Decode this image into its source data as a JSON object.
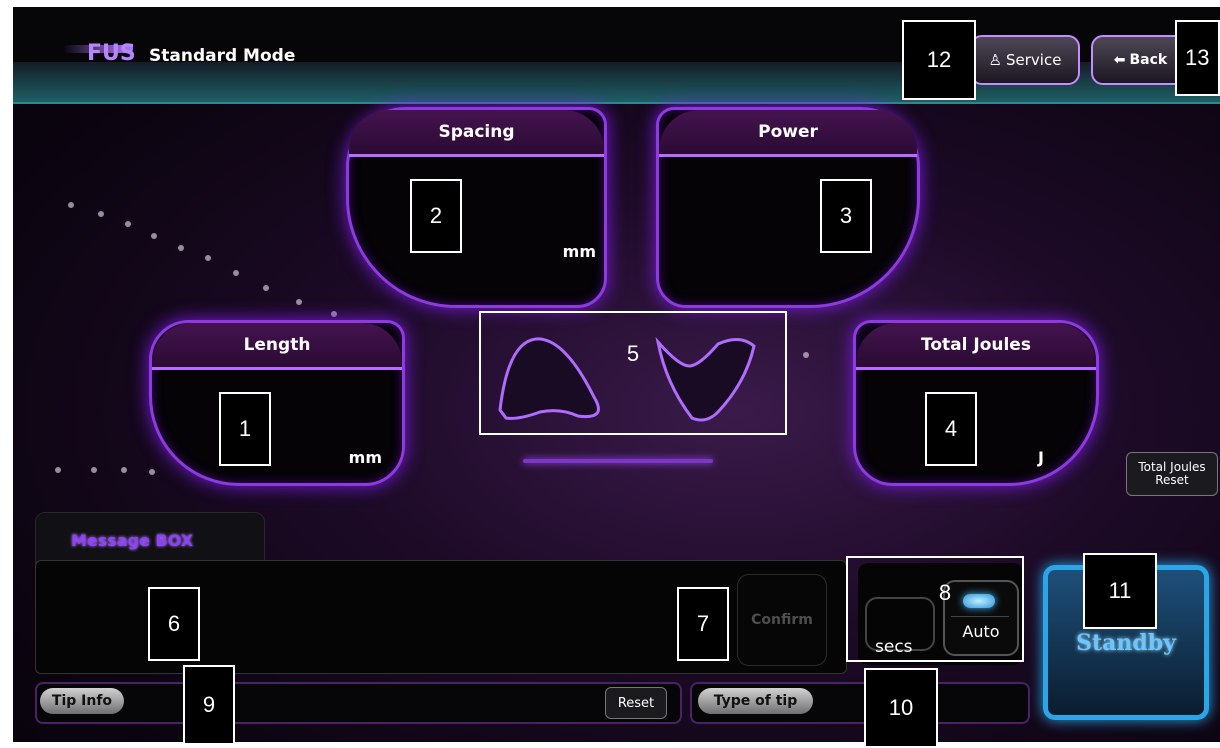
{
  "header": {
    "app_name": "FUS",
    "mode_title": "Standard Mode",
    "service_label": "Service",
    "service_icon": "person-icon",
    "back_label": "Back",
    "back_icon": "arrow-left-icon"
  },
  "panels": {
    "spacing": {
      "title": "Spacing",
      "unit": "mm"
    },
    "power": {
      "title": "Power"
    },
    "length": {
      "title": "Length",
      "unit": "mm"
    },
    "total_joules": {
      "title": "Total Joules",
      "unit": "J"
    }
  },
  "total_joules_reset_label": "Total Joules\nReset",
  "message_box": {
    "label": "Message BOX",
    "confirm_label": "Confirm"
  },
  "timer": {
    "unit": "secs",
    "auto_label": "Auto"
  },
  "standby_label": "Standby",
  "tip_info": {
    "label": "Tip Info",
    "reset_label": "Reset"
  },
  "type_of_tip_label": "Type of tip",
  "callouts": [
    "1",
    "2",
    "3",
    "4",
    "5",
    "6",
    "7",
    "8",
    "9",
    "10",
    "11",
    "12",
    "13"
  ],
  "colors": {
    "accent": "#8d3adf",
    "glow": "#7a1de0",
    "standby": "#2aa6e8",
    "header_teal": "#2b8a8f"
  }
}
